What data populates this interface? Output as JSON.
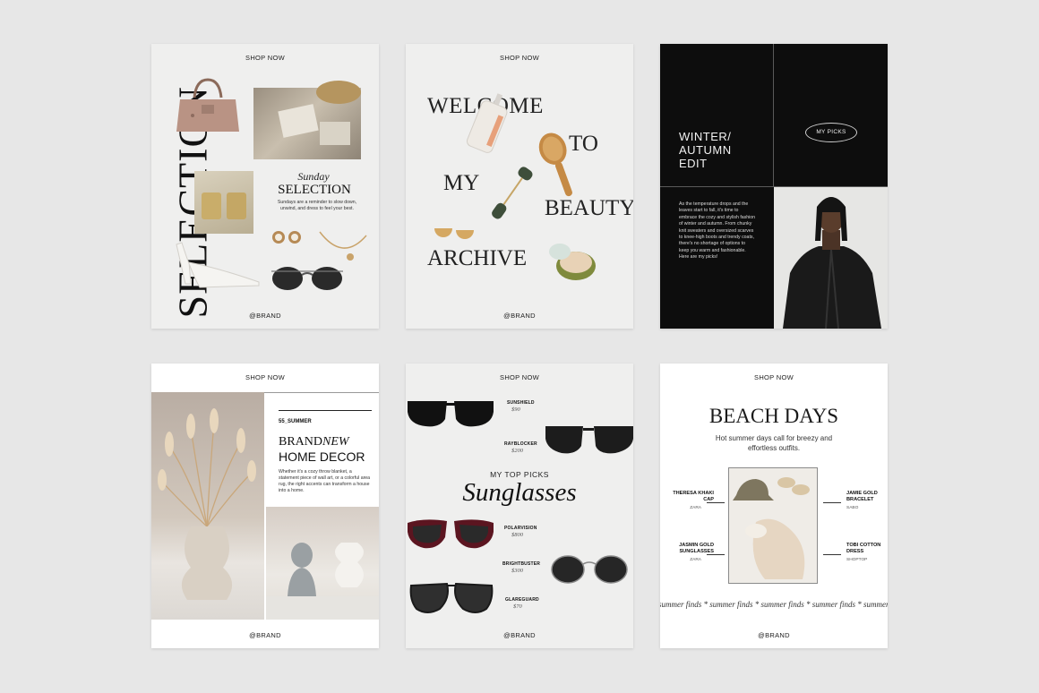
{
  "common": {
    "shop_now": "SHOP NOW",
    "brand": "@BRAND"
  },
  "card1": {
    "vertical_title": "SELECTION",
    "script_title": "Sunday",
    "title": "SELECTION",
    "body": "Sundays are a reminder to slow down, unwind, and dress to feel your best."
  },
  "card2": {
    "words": [
      "WELCOME",
      "TO",
      "MY",
      "BEAUTY",
      "ARCHIVE"
    ]
  },
  "card3": {
    "title_lines": [
      "WINTER/",
      "AUTUMN",
      "EDIT"
    ],
    "pill": "MY PICKS",
    "body": "As the temperature drops and the leaves start to fall, it's time to embrace the cozy and stylish fashion of winter and autumn. From chunky knit sweaters and oversized scarves to knee-high boots and trendy coats, there's no shortage of options to keep you warm and fashionable. Here are my picks!"
  },
  "card4": {
    "tag": "55_SUMMER",
    "title_a": "BRAND",
    "title_b": "NEW",
    "title_c": "HOME DECOR",
    "body": "Whether it's a cozy throw blanket, a statement piece of wall art, or a colorful area rug, the right accents can transform a house into a home."
  },
  "card5": {
    "kicker": "MY TOP PICKS",
    "title": "Sunglasses",
    "items": [
      {
        "name": "SUNSHIELD",
        "price": "$90"
      },
      {
        "name": "RAYBLOCKER",
        "price": "$200"
      },
      {
        "name": "POLARVISION",
        "price": "$800"
      },
      {
        "name": "BRIGHTBUSTER",
        "price": "$300"
      },
      {
        "name": "GLAREGUARD",
        "price": "$70"
      }
    ]
  },
  "card6": {
    "title": "BEACH DAYS",
    "subtitle": "Hot summer days call for breezy and effortless outfits.",
    "left_items": [
      {
        "name": "THERESA KHAKI CAP",
        "store": "ZARA"
      },
      {
        "name": "JASMIN GOLD SUNGLASSES",
        "store": "ZARA"
      }
    ],
    "right_items": [
      {
        "name": "JAMIE GOLD BRACELET",
        "store": "SABO"
      },
      {
        "name": "TOBI COTTON DRESS",
        "store": "SHOPTOP"
      }
    ],
    "ticker": "summer finds * summer finds * summer finds * summer finds * summer finds * summer finds"
  },
  "colors": {
    "background": "#e7e7e7",
    "card": "#efefee",
    "dark_card": "#0d0d0d",
    "ink": "#111111"
  }
}
